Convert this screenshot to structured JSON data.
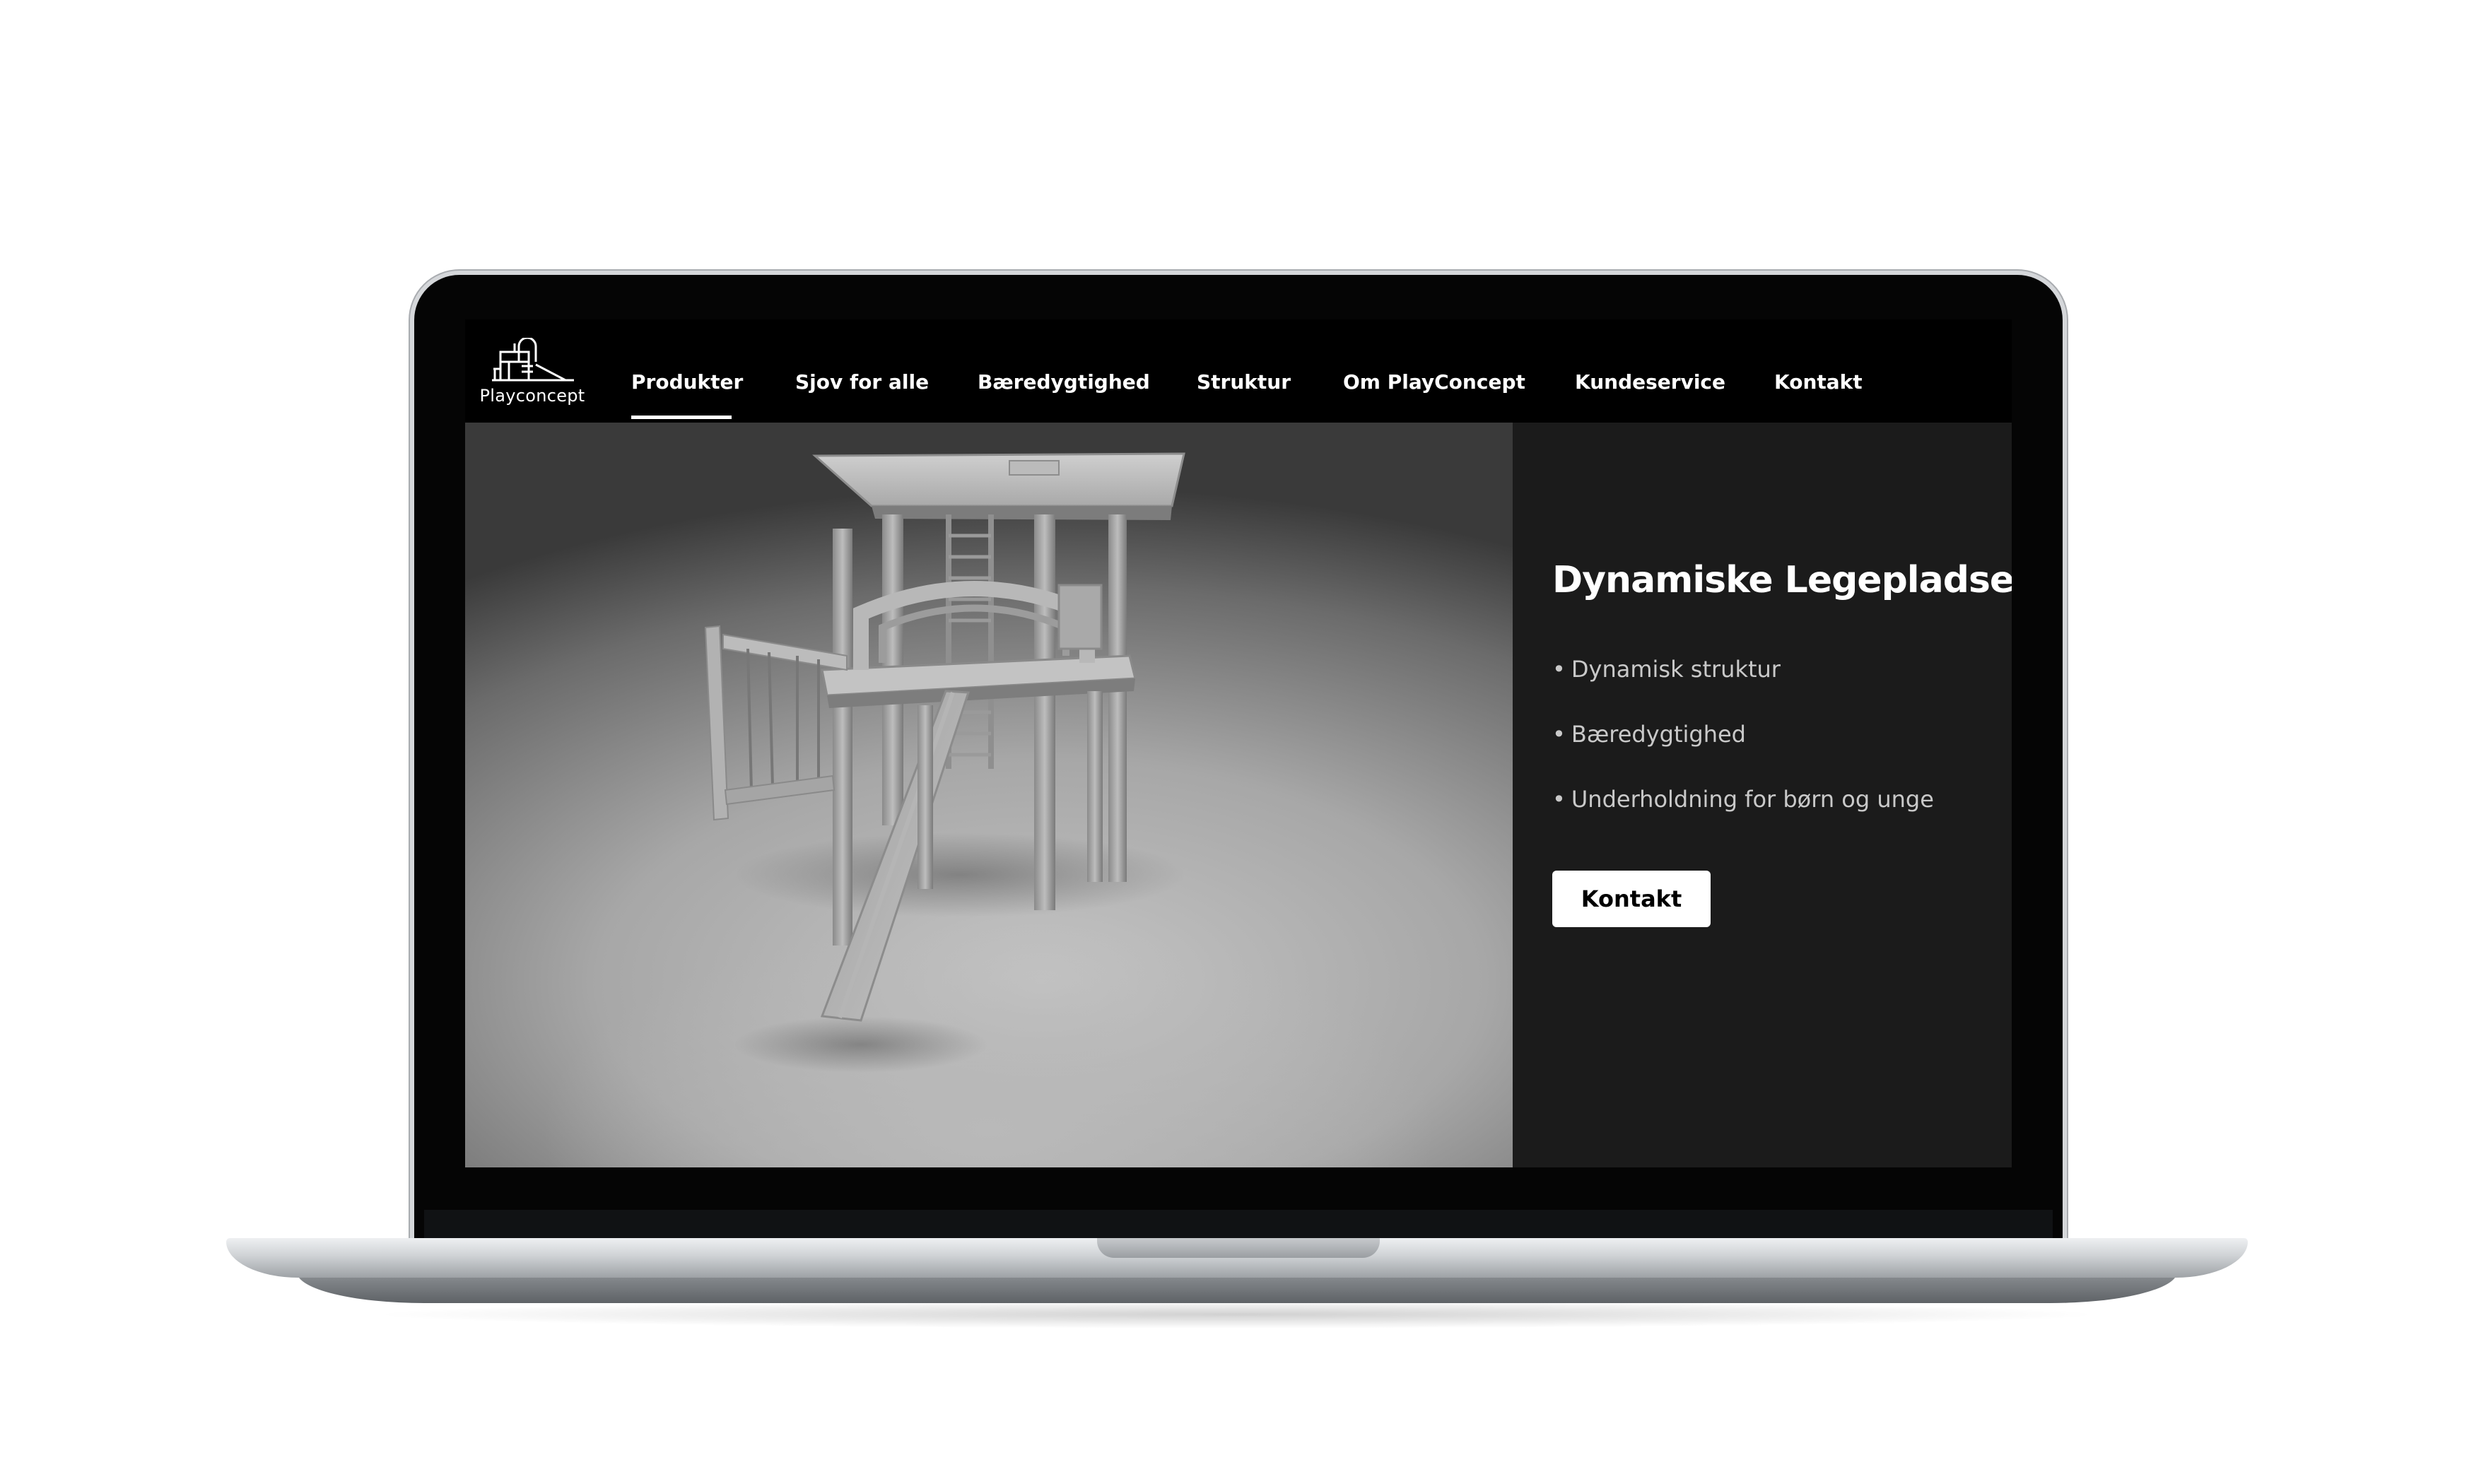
{
  "brand": {
    "name": "Playconcept",
    "icon": "playground-logo-icon"
  },
  "nav": {
    "items": [
      {
        "label": "Produkter",
        "active": true
      },
      {
        "label": "Sjov for alle",
        "active": false
      },
      {
        "label": "Bæredygtighed",
        "active": false
      },
      {
        "label": "Struktur",
        "active": false
      },
      {
        "label": "Om PlayConcept",
        "active": false
      },
      {
        "label": "Kundeservice",
        "active": false
      },
      {
        "label": "Kontakt",
        "active": false
      }
    ]
  },
  "hero": {
    "title": "Dynamiske Legepladser",
    "bullets": [
      "Dynamisk struktur",
      "Bæredygtighed",
      "Underholdning for børn og unge"
    ],
    "bullet_symbol": "•",
    "cta_label": "Kontakt",
    "image": "playground-tower-render"
  },
  "colors": {
    "page_bg": "#ffffff",
    "nav_bg": "#000000",
    "panel_bg": "#1b1b1b",
    "text_primary": "#ffffff",
    "text_secondary": "#c9c9c9",
    "button_bg": "#ffffff",
    "button_text": "#000000"
  }
}
